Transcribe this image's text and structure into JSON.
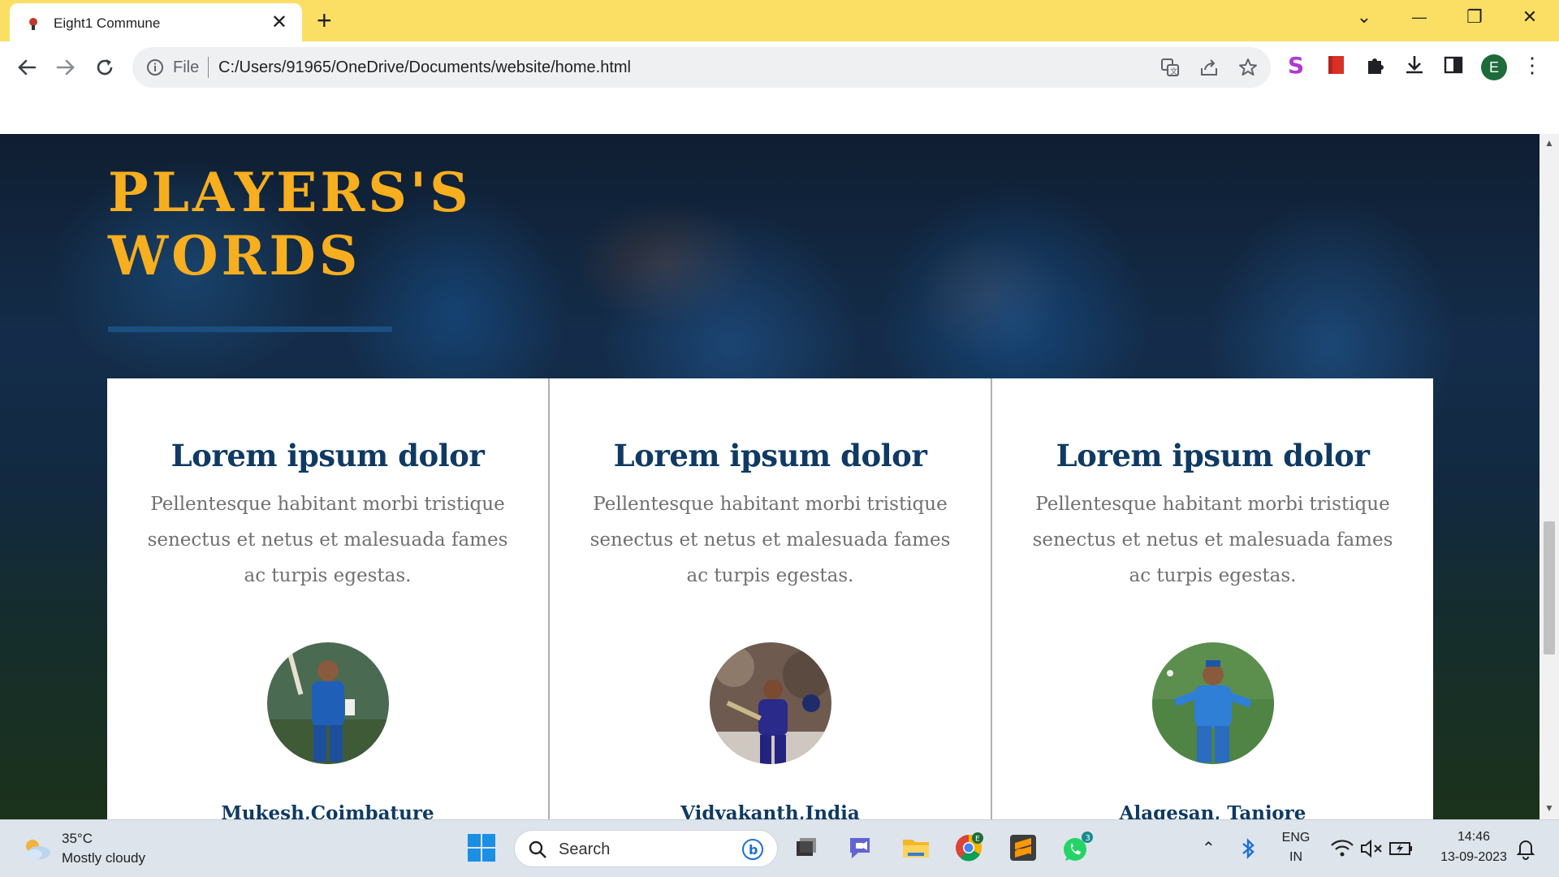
{
  "browser": {
    "tab_title": "Eight1 Commune",
    "tab_close": "✕",
    "new_tab": "+",
    "scheme": "File",
    "url": "C:/Users/91965/OneDrive/Documents/website/home.html",
    "profile_initial": "E",
    "window_controls": {
      "tab_search": "⌄",
      "minimize": "—",
      "restore": "❐",
      "close": "✕"
    }
  },
  "page": {
    "heading": "PLAYERS'S WORDS",
    "cards": [
      {
        "title": "Lorem ipsum dolor",
        "body": "Pellentesque habitant morbi tristique senectus et netus et malesuada fames ac turpis egestas.",
        "player": "Mukesh,Coimbature"
      },
      {
        "title": "Lorem ipsum dolor",
        "body": "Pellentesque habitant morbi tristique senectus et netus et malesuada fames ac turpis egestas.",
        "player": "Vidyakanth,India"
      },
      {
        "title": "Lorem ipsum dolor",
        "body": "Pellentesque habitant morbi tristique senectus et netus et malesuada fames ac turpis egestas.",
        "player": "Alagesan, Tanjore"
      }
    ],
    "colors": {
      "heading": "#f7ae1f",
      "card_title": "#0f3a63",
      "underline": "#1a4f80"
    }
  },
  "taskbar": {
    "weather_temp": "35°C",
    "weather_desc": "Mostly cloudy",
    "search_placeholder": "Search",
    "chrome_badge": "E",
    "whatsapp_badge": "3",
    "language": "ENG",
    "region": "IN",
    "time": "14:46",
    "date": "13-09-2023"
  }
}
